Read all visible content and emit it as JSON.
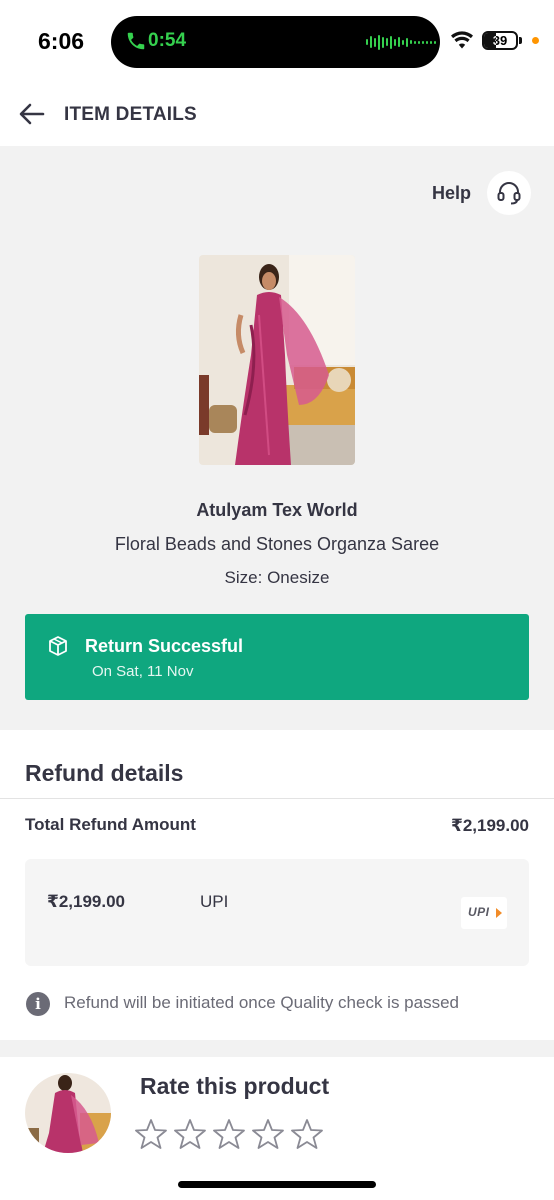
{
  "status_bar": {
    "time": "6:06",
    "call_timer": "0:54",
    "battery_level": "39"
  },
  "header": {
    "title": "ITEM DETAILS"
  },
  "help": {
    "label": "Help"
  },
  "product": {
    "seller": "Atulyam Tex World",
    "name": "Floral Beads and Stones Organza Saree",
    "size": "Size: Onesize"
  },
  "return_status": {
    "title": "Return Successful",
    "date": "On Sat, 11 Nov",
    "color": "#0fa77f"
  },
  "refund": {
    "title": "Refund details",
    "total_label": "Total Refund Amount",
    "total_value": "₹2,199.00",
    "payment_amount": "₹2,199.00",
    "payment_method": "UPI",
    "payment_logo_text": "UPI",
    "info_text": "Refund will be initiated once Quality check is passed"
  },
  "rating": {
    "title": "Rate this product",
    "stars_total": 5,
    "stars_filled": 0
  },
  "colors": {
    "text_primary": "#353543",
    "background_grey": "#f2f2f2",
    "accent_green": "#0fa77f",
    "call_green": "#35d04e"
  }
}
